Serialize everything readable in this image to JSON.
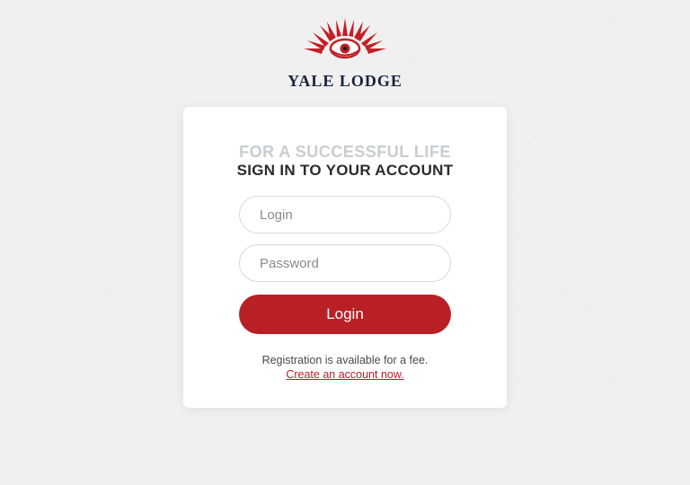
{
  "brand": {
    "name": "YALE LODGE"
  },
  "card": {
    "tagline": "FOR A SUCCESSFUL LIFE",
    "title": "SIGN IN TO YOUR ACCOUNT",
    "login_placeholder": "Login",
    "password_placeholder": "Password",
    "login_button": "Login",
    "registration_text": "Registration is available for a fee.",
    "create_account_link": "Create an account now."
  }
}
